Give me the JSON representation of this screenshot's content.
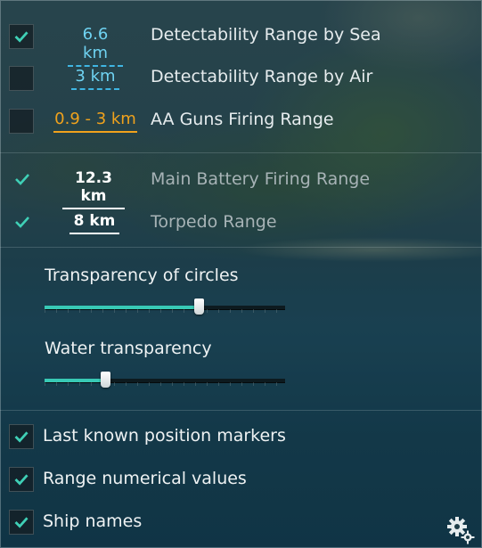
{
  "ranges": [
    {
      "checked": true,
      "style": "checkbox",
      "value": "6.6 km",
      "label": "Detectability Range by Sea"
    },
    {
      "checked": false,
      "style": "checkbox",
      "value": "3 km",
      "label": "Detectability Range by Air"
    },
    {
      "checked": false,
      "style": "checkbox",
      "value": "0.9 - 3 km",
      "label": "AA Guns Firing Range"
    },
    {
      "checked": true,
      "style": "fixed",
      "value": "12.3 km",
      "label": "Main Battery Firing Range"
    },
    {
      "checked": true,
      "style": "fixed",
      "value": "8 km",
      "label": "Torpedo Range"
    }
  ],
  "sliders": [
    {
      "label": "Transparency of circles",
      "value": 0.64
    },
    {
      "label": "Water transparency",
      "value": 0.25
    }
  ],
  "options": [
    {
      "checked": true,
      "label": "Last known position markers"
    },
    {
      "checked": true,
      "label": "Range numerical values"
    },
    {
      "checked": true,
      "label": "Ship names"
    }
  ],
  "colors": {
    "accent": "#38c9b5",
    "detect": "#6fd3f2",
    "aa": "#f0a21c"
  },
  "icons": {
    "settings": "gear-icon"
  }
}
